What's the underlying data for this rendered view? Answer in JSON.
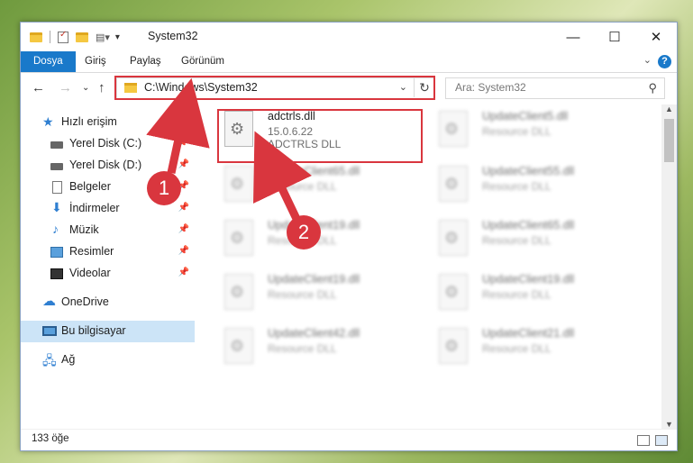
{
  "window": {
    "title": "System32"
  },
  "window_controls": {
    "minimize": "—",
    "maximize": "☐",
    "close": "✕"
  },
  "ribbon": {
    "tabs": [
      "Dosya",
      "Giriş",
      "Paylaş",
      "Görünüm"
    ],
    "help": "?"
  },
  "address": {
    "path": "C:\\Windows\\System32"
  },
  "search": {
    "placeholder": "Ara: System32"
  },
  "nav": {
    "quick_access": "Hızlı erişim",
    "items": [
      {
        "label": "Yerel Disk (C:)",
        "icon": "drive-icon"
      },
      {
        "label": "Yerel Disk (D:)",
        "icon": "drive-icon"
      },
      {
        "label": "Belgeler",
        "icon": "documents-icon"
      },
      {
        "label": "İndirmeler",
        "icon": "downloads-icon"
      },
      {
        "label": "Müzik",
        "icon": "music-icon"
      },
      {
        "label": "Resimler",
        "icon": "pictures-icon"
      },
      {
        "label": "Videolar",
        "icon": "videos-icon"
      }
    ],
    "onedrive": "OneDrive",
    "this_pc": "Bu bilgisayar",
    "network": "Ağ"
  },
  "files": {
    "selected": {
      "name": "adctrls.dll",
      "version": "15.0.6.22",
      "description": "ADCTRLS DLL"
    },
    "left_column": [
      {
        "name": "UpdateClient65.dll",
        "description": "Resource DLL"
      },
      {
        "name": "UpdateClient19.dll",
        "description": "Resource DLL"
      },
      {
        "name": "UpdateClient19.dll",
        "description": "Resource DLL"
      },
      {
        "name": "UpdateClient42.dll",
        "description": "Resource DLL"
      }
    ],
    "right_column": [
      {
        "name": "UpdateClient5.dll",
        "description": "Resource DLL"
      },
      {
        "name": "UpdateClient55.dll",
        "description": "Resource DLL"
      },
      {
        "name": "UpdateClient65.dll",
        "description": "Resource DLL"
      },
      {
        "name": "UpdateClient19.dll",
        "description": "Resource DLL"
      },
      {
        "name": "UpdateClient21.dll",
        "description": "Resource DLL"
      }
    ]
  },
  "status": {
    "item_count": "133 öğe"
  },
  "annotations": {
    "step1": "1",
    "step2": "2",
    "color": "#d9363e"
  }
}
